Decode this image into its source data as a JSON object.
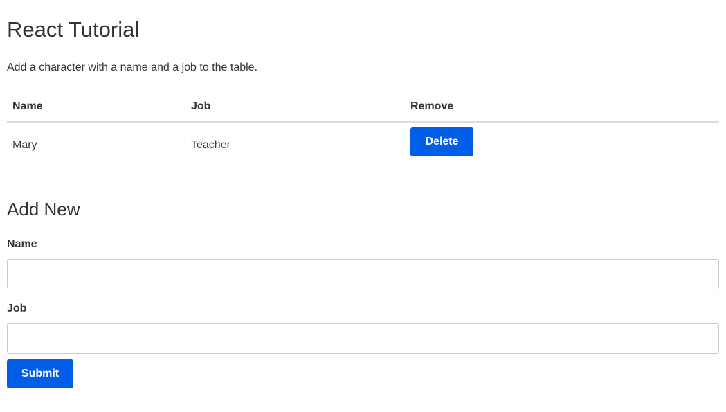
{
  "page": {
    "title": "React Tutorial",
    "intro": "Add a character with a name and a job to the table."
  },
  "table": {
    "headers": {
      "name": "Name",
      "job": "Job",
      "remove": "Remove"
    },
    "rows": [
      {
        "name": "Mary",
        "job": "Teacher",
        "action_label": "Delete"
      }
    ]
  },
  "form": {
    "title": "Add New",
    "name_label": "Name",
    "name_value": "",
    "job_label": "Job",
    "job_value": "",
    "submit_label": "Submit"
  },
  "colors": {
    "accent": "#005ee9",
    "text": "#333333",
    "border": "#dddddd"
  }
}
